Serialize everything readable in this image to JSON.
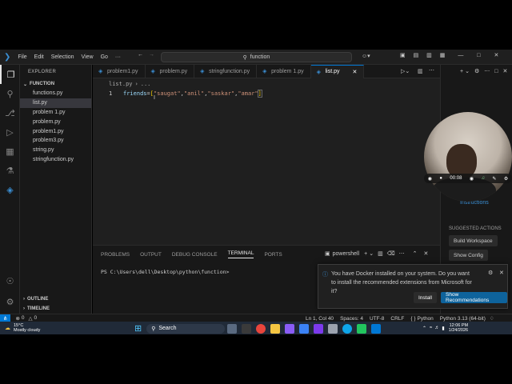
{
  "titlebar": {
    "menu": [
      "File",
      "Edit",
      "Selection",
      "View",
      "Go",
      "···"
    ],
    "search": "function"
  },
  "sidebar": {
    "header": "EXPLORER",
    "folder": "FUNCTION",
    "files": [
      "functions.py",
      "list.py",
      "problem 1.py",
      "problem.py",
      "problem1.py",
      "problem3.py",
      "string.py",
      "stringfunction.py"
    ],
    "outline": "OUTLINE",
    "timeline": "TIMELINE"
  },
  "tabs": [
    "problem1.py",
    "problem.py",
    "stringfunction.py",
    "problem 1.py",
    "list.py"
  ],
  "editor": {
    "breadcrumb": [
      "list.py",
      "..."
    ],
    "line_no": "1",
    "code": {
      "var": "friends",
      "eq": "=",
      "open": "[",
      "items": [
        "\"saugat\"",
        "\"anil\"",
        "\"saskar\"",
        "\"amar\""
      ],
      "close": "]"
    }
  },
  "panel": {
    "tabs": [
      "PROBLEMS",
      "OUTPUT",
      "DEBUG CONSOLE",
      "TERMINAL",
      "PORTS"
    ],
    "shell": "powershell",
    "prompt": "PS C:\\Users\\dell\\Desktop\\python\\function>"
  },
  "right_pane": {
    "instructions": "Instructions",
    "suggested": "SUGGESTED ACTIONS",
    "build": "Build Workspace",
    "show_config": "Show Config"
  },
  "notification": {
    "message": "You have Docker installed on your system. Do you want to install the recommended extensions from Microsoft for it?",
    "install": "Install",
    "show": "Show Recommendations"
  },
  "statusbar": {
    "errors": "0",
    "warnings": "0",
    "position": "Ln 1, Col 40",
    "spaces": "Spaces: 4",
    "encoding": "UTF-8",
    "eol": "CRLF",
    "language": "Python",
    "interpreter": "Python 3.13 (64-bit)"
  },
  "taskbar": {
    "weather_temp": "15°C",
    "weather_desc": "Mostly cloudy",
    "search": "Search",
    "time": "12:06 PM",
    "date": "1/24/2026"
  },
  "webcam": {
    "timer": "00:08"
  },
  "colors": {
    "accent": "#0078d4",
    "notif_button": "#0e639c"
  }
}
